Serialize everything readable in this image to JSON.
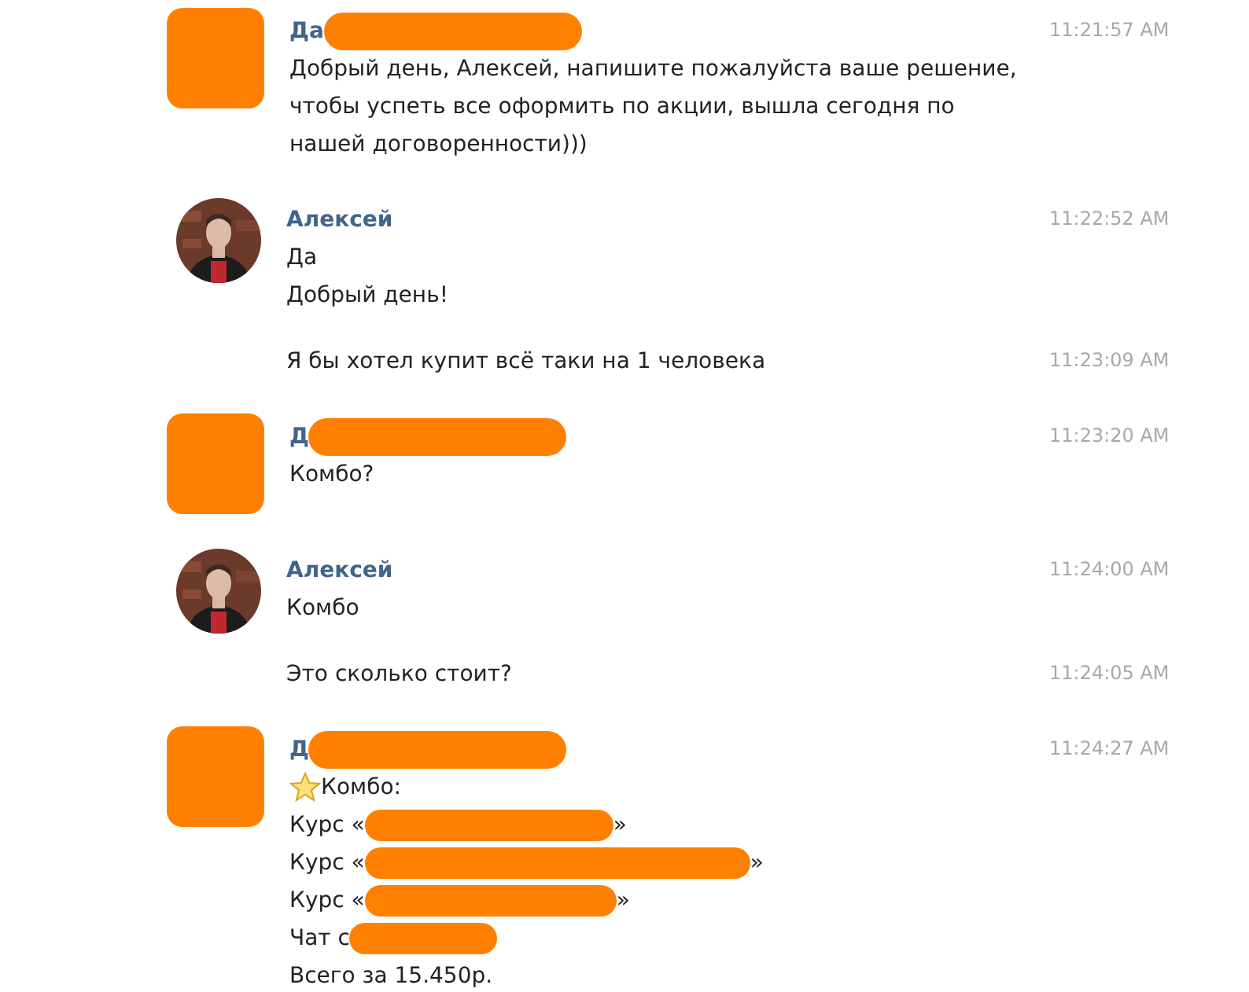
{
  "conversation": [
    {
      "sender": {
        "name": "Да",
        "name_redacted": true,
        "avatar_redacted": true
      },
      "messages": [
        {
          "time": "11:21:57 AM",
          "lines": [
            [
              {
                "kind": "text",
                "text": "Добрый день, Алексей, напишите пожалуйста ваше решение, чтобы успеть все оформить по акции, вышла сегодня по нашей договоренности)))"
              }
            ]
          ]
        }
      ]
    },
    {
      "sender": {
        "name": "Алексей",
        "name_redacted": false,
        "avatar_redacted": false
      },
      "messages": [
        {
          "time": "11:22:52 AM",
          "lines": [
            [
              {
                "kind": "text",
                "text": "Да"
              }
            ],
            [
              {
                "kind": "text",
                "text": "Добрый день!"
              }
            ]
          ]
        },
        {
          "time": "11:23:09 AM",
          "lines": [
            [
              {
                "kind": "text",
                "text": "Я бы хотел купит всё таки на 1 человека"
              }
            ]
          ]
        }
      ]
    },
    {
      "sender": {
        "name": "Д",
        "name_redacted": true,
        "avatar_redacted": true
      },
      "messages": [
        {
          "time": "11:23:20 AM",
          "lines": [
            [
              {
                "kind": "text",
                "text": "Комбо?"
              }
            ]
          ]
        }
      ]
    },
    {
      "sender": {
        "name": "Алексей",
        "name_redacted": false,
        "avatar_redacted": false
      },
      "messages": [
        {
          "time": "11:24:00 AM",
          "lines": [
            [
              {
                "kind": "text",
                "text": "Комбо"
              }
            ]
          ]
        },
        {
          "time": "11:24:05 AM",
          "lines": [
            [
              {
                "kind": "text",
                "text": "Это сколько стоит?"
              }
            ]
          ]
        }
      ]
    },
    {
      "sender": {
        "name": "Д",
        "name_redacted": true,
        "avatar_redacted": true
      },
      "messages": [
        {
          "time": "11:24:27 AM",
          "lines": [
            [
              {
                "kind": "star"
              },
              {
                "kind": "text",
                "text": "Комбо:"
              }
            ],
            [
              {
                "kind": "text",
                "text": "Курс «"
              },
              {
                "kind": "redaction"
              },
              {
                "kind": "text",
                "text": "»"
              }
            ],
            [
              {
                "kind": "text",
                "text": "Курс «"
              },
              {
                "kind": "redaction"
              },
              {
                "kind": "text",
                "text": "»"
              }
            ],
            [
              {
                "kind": "text",
                "text": "Курс «"
              },
              {
                "kind": "redaction"
              },
              {
                "kind": "text",
                "text": "»"
              }
            ],
            [
              {
                "kind": "text",
                "text": "Чат с"
              },
              {
                "kind": "redaction"
              }
            ],
            [
              {
                "kind": "text",
                "text": "Всего за 15.450р."
              }
            ]
          ]
        }
      ]
    }
  ]
}
